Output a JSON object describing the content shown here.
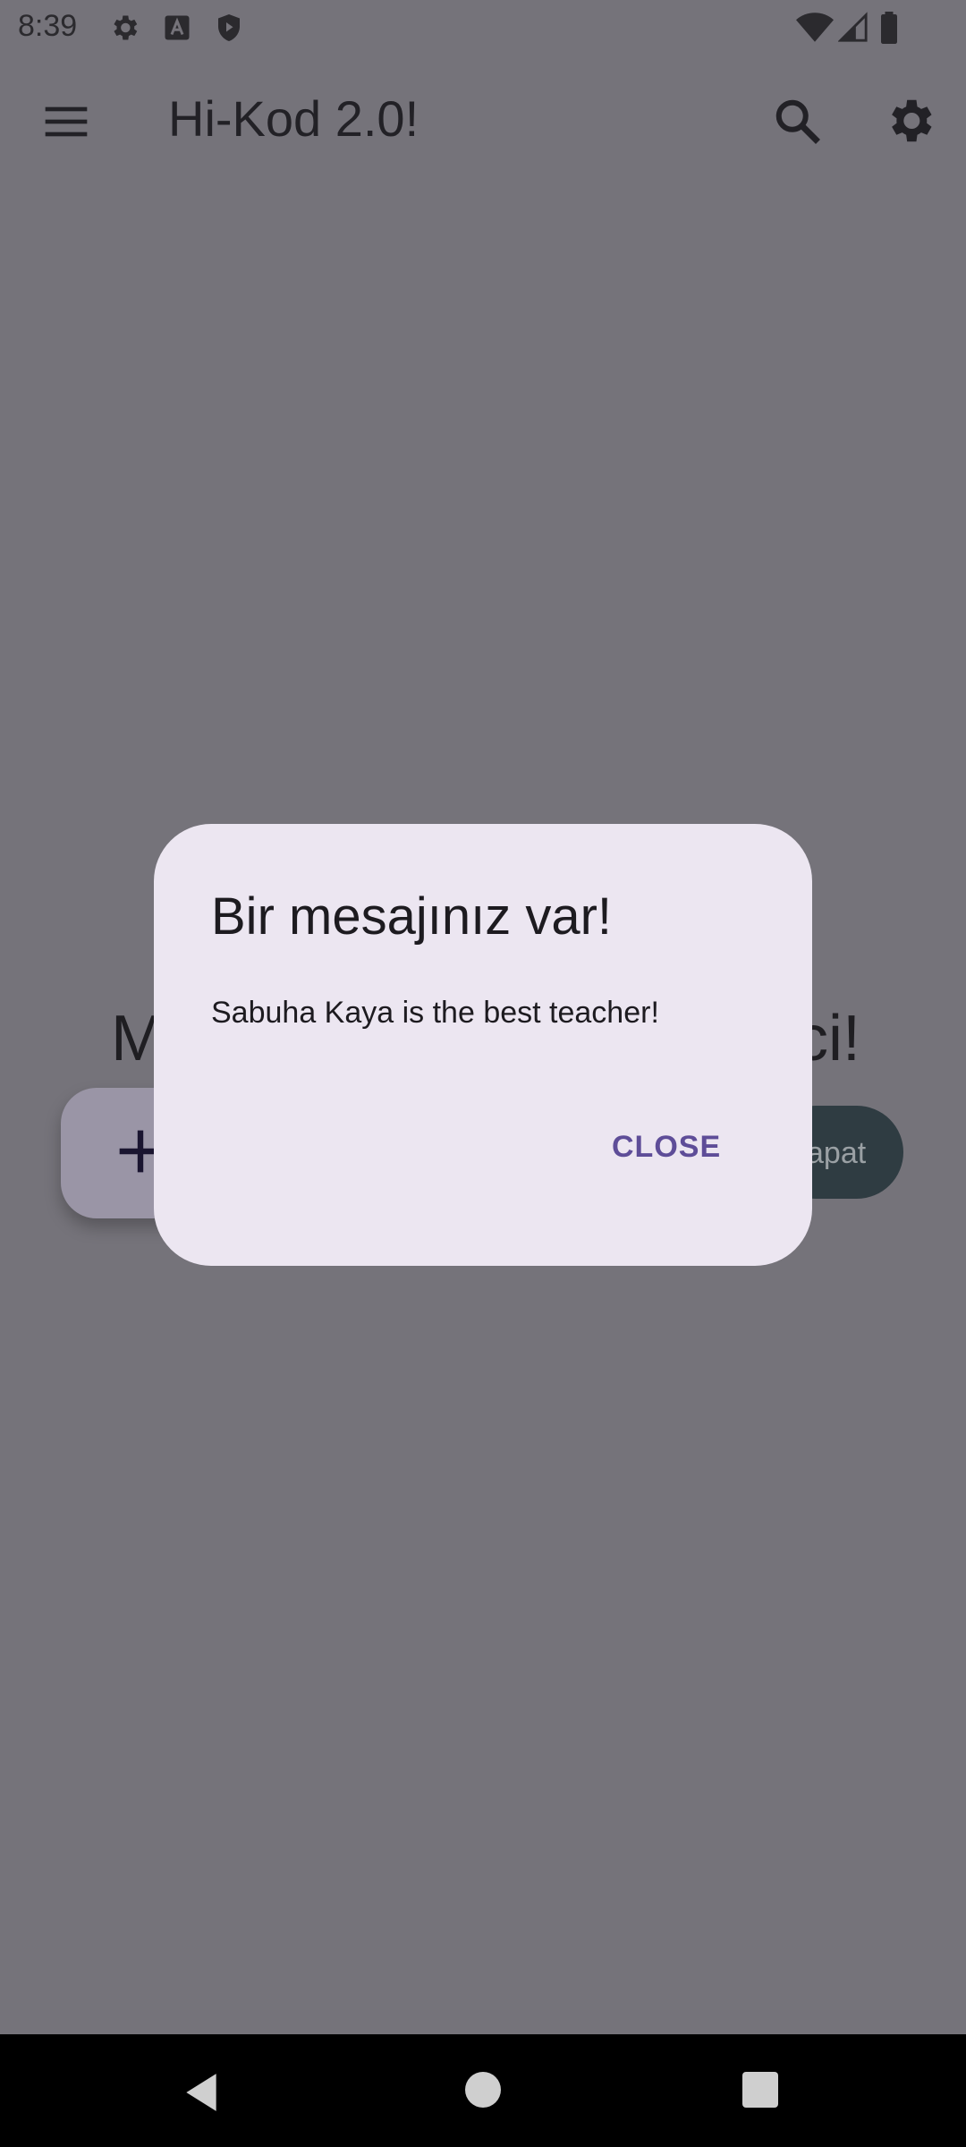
{
  "status_bar": {
    "time": "8:39",
    "left_icons": [
      "settings-icon",
      "a-icon",
      "shield-icon"
    ],
    "right_icons": [
      "wifi-icon",
      "signal-icon",
      "battery-icon"
    ]
  },
  "app_bar": {
    "title": "Hi-Kod 2.0!",
    "icons": [
      "menu-icon",
      "search-icon",
      "gear-icon"
    ]
  },
  "background": {
    "partial_text_left": "M",
    "partial_text_right": "ci!",
    "fab_icon": "plus-icon",
    "pill_text": "apat"
  },
  "dialog": {
    "title": "Bir mesajınız var!",
    "message": "Sabuha Kaya is the best teacher!",
    "close_label": "CLOSE"
  },
  "nav_bar": {
    "icons": [
      "back-icon",
      "home-icon",
      "recents-icon"
    ]
  },
  "colors": {
    "scrim": "#75737a",
    "dialog_bg": "#ece6f1",
    "accent": "#5e4d98",
    "nav_bar": "#000000"
  }
}
